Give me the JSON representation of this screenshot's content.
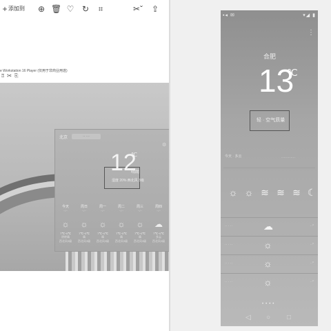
{
  "viewer": {
    "toolbar": {
      "add_icon": "+",
      "add_label": "添加到",
      "zoom_icon": "⊕",
      "delete_icon": "🗑",
      "favorite_icon": "♡",
      "rotate_icon": "↻",
      "crop_icon": "⌗",
      "edit_icon": "✂ˇ",
      "share_icon": "⇪"
    },
    "vm_label": "e Workstation 16 Player (仅用于非商业用途)",
    "vm_icons": "⍰ ✂ ⎘"
  },
  "inner_widget": {
    "city": "北京",
    "search_placeholder": "·· ···",
    "settings_icon": "⚙",
    "temp": "12",
    "unit": "℃",
    "condition": "晴朗",
    "detail": "湿度 20%  西北风 3级",
    "days": [
      {
        "name": "今天",
        "date": "··/··",
        "icon": "☼",
        "temp": "7℃~0℃",
        "weather": "阴转晴",
        "wind": "西北风3级"
      },
      {
        "name": "周日",
        "date": "··/··",
        "icon": "☼",
        "temp": "7℃~0℃",
        "weather": "晴",
        "wind": "西北风3级"
      },
      {
        "name": "周一",
        "date": "··/··",
        "icon": "☼",
        "temp": "7℃~0℃",
        "weather": "晴",
        "wind": "西北风3级"
      },
      {
        "name": "周二",
        "date": "··/··",
        "icon": "☼",
        "temp": "7℃~0℃",
        "weather": "晴",
        "wind": "西北风3级"
      },
      {
        "name": "周三",
        "date": "··/··",
        "icon": "☼",
        "temp": "7℃~0℃",
        "weather": "晴",
        "wind": "西北风3级"
      },
      {
        "name": "周四",
        "date": "··/··",
        "icon": "☁",
        "temp": "7℃~0℃",
        "weather": "多云",
        "wind": "西北风3级"
      }
    ]
  },
  "phone": {
    "status_left": "▪◂ ✉",
    "status_right": "▾◢ ▮",
    "menu_icon": "⋮",
    "city": "合肥",
    "temp": "13",
    "unit": "℃",
    "air_quality": "轻 · 空气质量",
    "today_left": "今天 · 多云",
    "today_right": "············",
    "hourly_icons": [
      "☼",
      "☼",
      "≋",
      "≋",
      "≋",
      "☾"
    ],
    "forecast": [
      {
        "day": "·· · ··",
        "icon": "☁",
        "temp": "··°"
      },
      {
        "day": "·· · ··",
        "icon": "☼",
        "temp": "··°"
      },
      {
        "day": "·· · ··",
        "icon": "☼",
        "temp": "··°"
      },
      {
        "day": "·· · ··",
        "icon": "☼",
        "temp": "··°"
      },
      {
        "day": "·· · ··",
        "icon": "☼",
        "temp": "··°"
      }
    ],
    "page_dots": "••••",
    "nav_back": "◁",
    "nav_home": "○",
    "nav_recent": "□"
  }
}
